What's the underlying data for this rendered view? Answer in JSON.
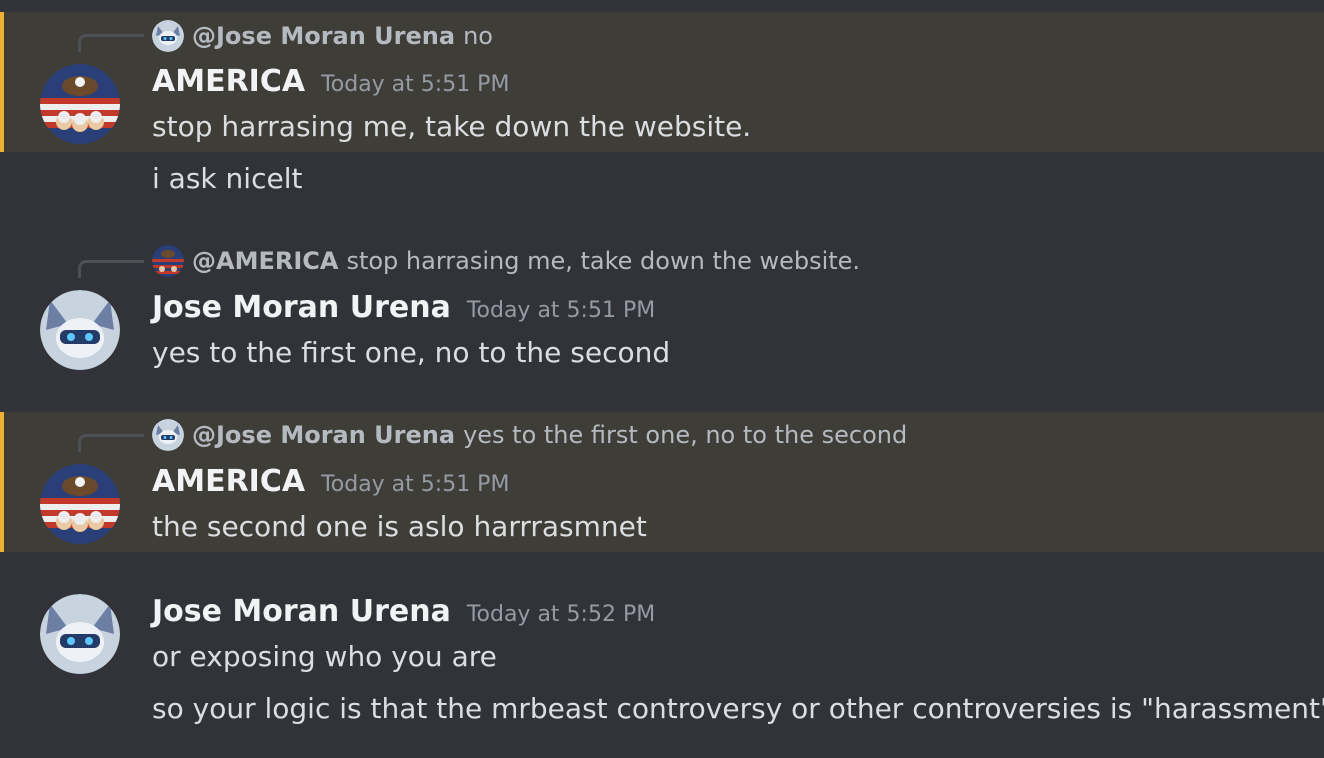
{
  "messages": [
    {
      "reply": {
        "mention": "@Jose Moran Urena",
        "text": "no"
      },
      "author": "AMERICA",
      "timestamp": "Today at 5:51 PM",
      "lines": [
        "stop harrasing me, take down the website.",
        "i ask nicelt"
      ]
    },
    {
      "reply": {
        "mention": "@AMERICA",
        "text": "stop harrasing me, take down the website."
      },
      "author": "Jose Moran Urena",
      "timestamp": "Today at 5:51 PM",
      "lines": [
        "yes to the first one, no to the second"
      ]
    },
    {
      "reply": {
        "mention": "@Jose Moran Urena",
        "text": "yes to the first one, no to the second"
      },
      "author": "AMERICA",
      "timestamp": "Today at 5:51 PM",
      "lines": [
        "the second one is aslo harrrasmnet"
      ]
    },
    {
      "author": "Jose Moran Urena",
      "timestamp": "Today at 5:52 PM",
      "lines": [
        "or exposing who you are",
        "so your logic is that the mrbeast controversy or other controversies is \"harassment\""
      ]
    }
  ],
  "colors": {
    "background": "#313338",
    "highlight_background": "#3f3d38",
    "highlight_border": "#f0b132",
    "username": "#f2f3f5",
    "timestamp": "#949ba4",
    "reply_text": "#b5bac1"
  }
}
